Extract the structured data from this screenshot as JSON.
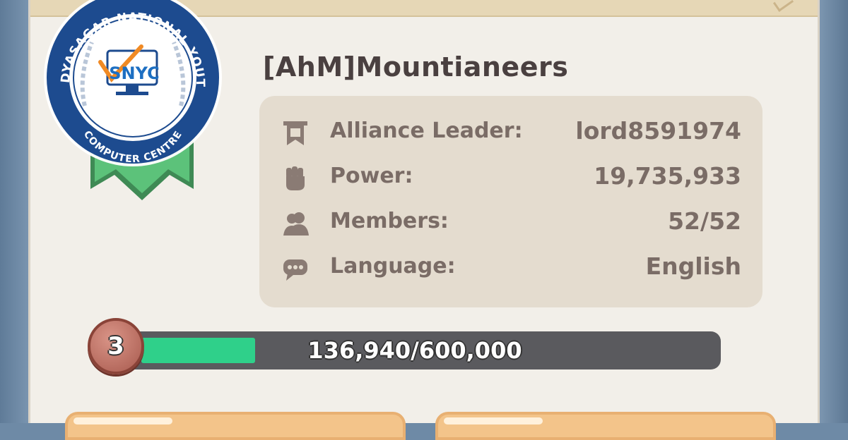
{
  "alliance": {
    "name": "[AhM]Mountianeers"
  },
  "info": [
    {
      "icon": "banner-icon",
      "label": "Alliance Leader:",
      "value": "lord8591974"
    },
    {
      "icon": "fist-icon",
      "label": "Power:",
      "value": "19,735,933"
    },
    {
      "icon": "members-icon",
      "label": "Members:",
      "value": "52/52"
    },
    {
      "icon": "chat-icon",
      "label": "Language:",
      "value": "English"
    }
  ],
  "progress": {
    "level": "3",
    "text": "136,940/600,000",
    "current": 136940,
    "max": 600000,
    "fill_color": "#2fd08a"
  },
  "watermark": {
    "ring_text_top": "VIDYASAGAR NATIONAL YOUTH",
    "ring_text_bottom": "COMPUTER CENTRE",
    "center_text": "SNYC"
  },
  "colors": {
    "panel": "#f2efe9",
    "info_box": "#e4dccf",
    "text": "#7a6c66",
    "banner_green": "#5cc27a"
  }
}
